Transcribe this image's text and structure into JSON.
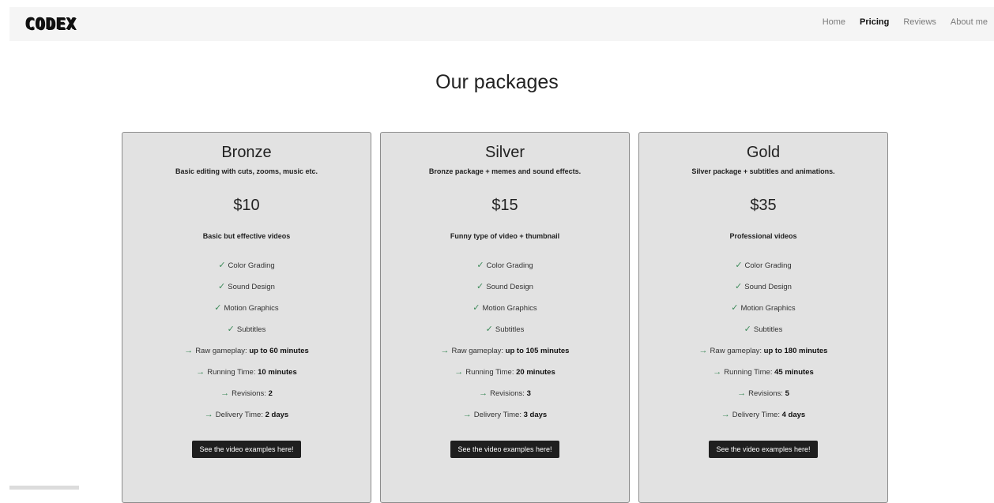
{
  "nav": {
    "logo": "CODEX",
    "links": [
      "Home",
      "Pricing",
      "Reviews",
      "About me"
    ],
    "active": "Pricing"
  },
  "heading": "Our packages",
  "cards": [
    {
      "title": "Bronze",
      "description": "Basic editing with cuts, zooms, music etc.",
      "price": "$10",
      "tagline": "Basic but effective videos",
      "checks": [
        "Color Grading",
        "Sound Design",
        "Motion Graphics",
        "Subtitles"
      ],
      "details": [
        {
          "label": "Raw gameplay: ",
          "value": "up to 60 minutes"
        },
        {
          "label": "Running Time: ",
          "value": "10 minutes"
        },
        {
          "label": "Revisions: ",
          "value": "2"
        },
        {
          "label": "Delivery Time: ",
          "value": "2 days"
        }
      ],
      "button": "See the video examples here!"
    },
    {
      "title": "Silver",
      "description": "Bronze package + memes and sound effects.",
      "price": "$15",
      "tagline": "Funny type of video + thumbnail",
      "checks": [
        "Color Grading",
        "Sound Design",
        "Motion Graphics",
        "Subtitles"
      ],
      "details": [
        {
          "label": "Raw gameplay: ",
          "value": "up to 105 minutes"
        },
        {
          "label": "Running Time: ",
          "value": "20 minutes"
        },
        {
          "label": "Revisions: ",
          "value": "3"
        },
        {
          "label": "Delivery Time: ",
          "value": "3 days"
        }
      ],
      "button": "See the video examples here!"
    },
    {
      "title": "Gold",
      "description": "Silver package + subtitles and animations.",
      "price": "$35",
      "tagline": "Professional videos",
      "checks": [
        "Color Grading",
        "Sound Design",
        "Motion Graphics",
        "Subtitles"
      ],
      "details": [
        {
          "label": "Raw gameplay: ",
          "value": "up to 180 minutes"
        },
        {
          "label": "Running Time: ",
          "value": "45 minutes"
        },
        {
          "label": "Revisions: ",
          "value": "5"
        },
        {
          "label": "Delivery Time: ",
          "value": "4 days"
        }
      ],
      "button": "See the video examples here!"
    }
  ],
  "icons": {
    "check": "check-icon",
    "arrow": "arrow-right-icon"
  },
  "colors": {
    "accent": "#3d8b5a",
    "card_bg": "#e2e2e2",
    "button_bg": "#1f1f1f",
    "navbar_bg": "#f5f5f5"
  }
}
